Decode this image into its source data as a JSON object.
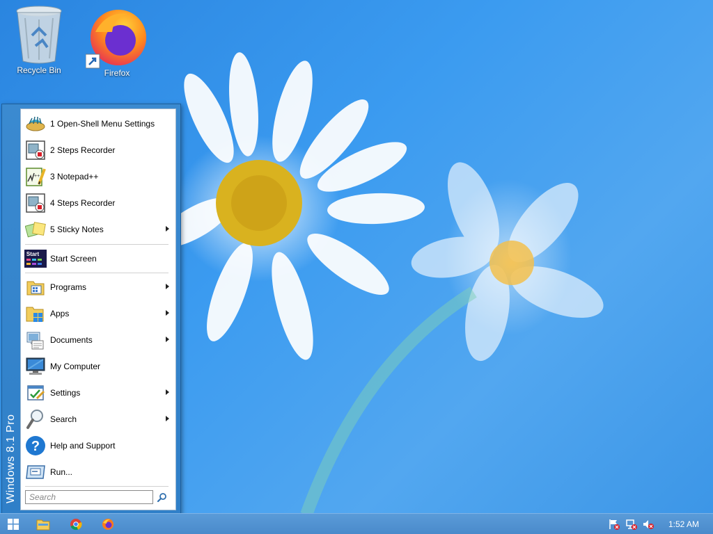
{
  "desktop": {
    "icons": [
      {
        "label": "Recycle Bin",
        "icon": "recycle-bin-icon"
      },
      {
        "label": "Firefox",
        "icon": "firefox-icon"
      }
    ]
  },
  "start_menu": {
    "banner": "Windows 8.1 Pro",
    "items": [
      {
        "label": "1 Open-Shell Menu Settings",
        "icon": "open-shell-icon",
        "submenu": false
      },
      {
        "label": "2 Steps Recorder",
        "icon": "steps-recorder-icon",
        "submenu": false
      },
      {
        "label": "3 Notepad++",
        "icon": "notepad-plus-plus-icon",
        "submenu": false
      },
      {
        "label": "4 Steps Recorder",
        "icon": "steps-recorder-icon",
        "submenu": false
      },
      {
        "label": "5 Sticky Notes",
        "icon": "sticky-notes-icon",
        "submenu": true
      },
      {
        "label": "Start Screen",
        "icon": "start-screen-icon",
        "submenu": false
      },
      {
        "label": "Programs",
        "icon": "programs-icon",
        "submenu": true
      },
      {
        "label": "Apps",
        "icon": "apps-folder-icon",
        "submenu": true
      },
      {
        "label": "Documents",
        "icon": "documents-icon",
        "submenu": true
      },
      {
        "label": "My Computer",
        "icon": "computer-icon",
        "submenu": false
      },
      {
        "label": "Settings",
        "icon": "settings-icon",
        "submenu": true
      },
      {
        "label": "Search",
        "icon": "magnifier-icon",
        "submenu": true
      },
      {
        "label": "Help and Support",
        "icon": "help-icon",
        "submenu": false
      },
      {
        "label": "Run...",
        "icon": "run-icon",
        "submenu": false
      }
    ],
    "start_screen_icon_text": "Start",
    "search": {
      "placeholder": "Search"
    }
  },
  "taskbar": {
    "start_button": "windows-logo-icon",
    "pinned": [
      "file-explorer-icon",
      "chrome-icon",
      "firefox-icon"
    ],
    "tray": [
      "action-center-flag-icon",
      "network-icon",
      "volume-muted-icon"
    ],
    "clock": "1:52 AM"
  },
  "colors": {
    "accent": "#2f7fc8",
    "taskbar": "#4a8acb",
    "wallpaper": "#3b9bf0"
  }
}
